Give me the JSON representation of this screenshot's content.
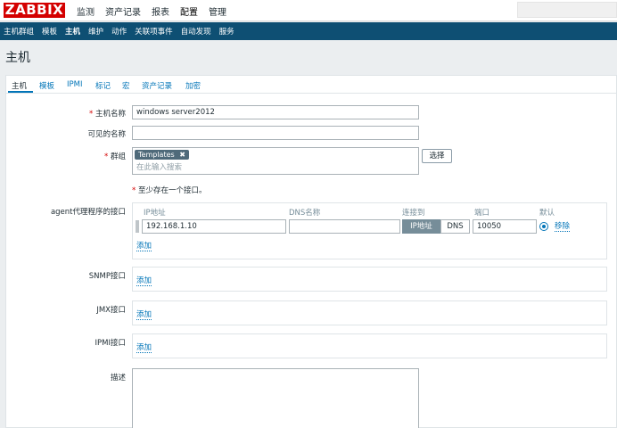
{
  "app": {
    "logo": "ZABBIX"
  },
  "topmenu": [
    "监测",
    "资产记录",
    "报表",
    "配置",
    "管理"
  ],
  "submenu": [
    "主机群组",
    "模板",
    "主机",
    "维护",
    "动作",
    "关联项事件",
    "自动发现",
    "服务"
  ],
  "page": {
    "title": "主机"
  },
  "tabs": [
    "主机",
    "模板",
    "IPMI",
    "标记",
    "宏",
    "资产记录",
    "加密"
  ],
  "form": {
    "host_name_label": "主机名称",
    "host_name_value": "windows server2012",
    "visible_name_label": "可见的名称",
    "visible_name_value": "",
    "groups_label": "群组",
    "group_tag": "Templates",
    "group_tag_remove": "✖",
    "groups_placeholder": "在此输入搜索",
    "select_button": "选择",
    "required_mark": "*",
    "interface_note": "至少存在一个接口。",
    "agent_label": "agent代理程序的接口",
    "col_ip": "IP地址",
    "col_dns": "DNS名称",
    "col_connect": "连接到",
    "col_port": "端口",
    "col_default": "默认",
    "agent_ip": "192.168.1.10",
    "agent_dns": "",
    "connect_ip": "IP地址",
    "connect_dns": "DNS",
    "agent_port": "10050",
    "remove_link": "移除",
    "add_link": "添加",
    "snmp_label": "SNMP接口",
    "jmx_label": "JMX接口",
    "ipmi_label": "IPMI接口",
    "description_label": "描述"
  },
  "colors": {
    "brand": "#d40000",
    "navbar": "#0e4f73",
    "link": "#0275b8"
  }
}
